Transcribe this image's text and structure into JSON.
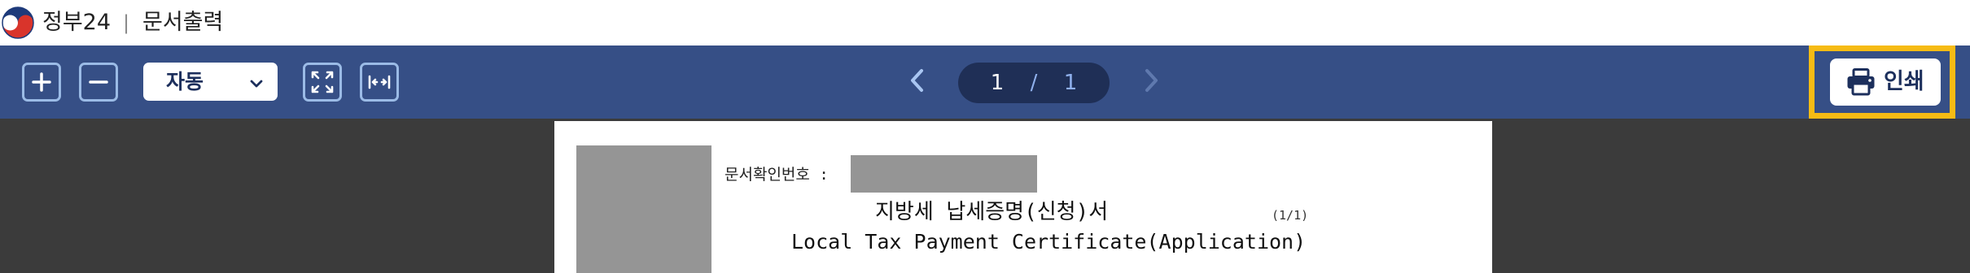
{
  "header": {
    "brand": "정부24",
    "separator": "|",
    "page_title": "문서출력",
    "logo_icon": "taegeuk-logo-icon"
  },
  "toolbar": {
    "zoom_in_icon": "plus-square-icon",
    "zoom_out_icon": "minus-square-icon",
    "zoom_select": {
      "value": "자동",
      "icon": "chevron-down-icon"
    },
    "fit_page_icon": "fit-page-icon",
    "fit_width_icon": "fit-width-icon",
    "prev_icon": "chevron-left-icon",
    "next_icon": "chevron-right-icon",
    "pager": {
      "current": "1",
      "separator": "/",
      "total": "1"
    },
    "print": {
      "label": "인쇄",
      "icon": "printer-icon"
    }
  },
  "document": {
    "doc_number_label": "문서확인번호 :",
    "title_kr": "지방세 납세증명(신청)서",
    "title_en": "Local Tax Payment Certificate(Application)",
    "page_indicator": "(1/1)"
  },
  "colors": {
    "toolbar_bg": "#364f86",
    "pager_bg": "#1f2f56",
    "print_highlight": "#f6bb14",
    "viewer_bg": "#3b3b3b",
    "redaction": "#959595"
  }
}
